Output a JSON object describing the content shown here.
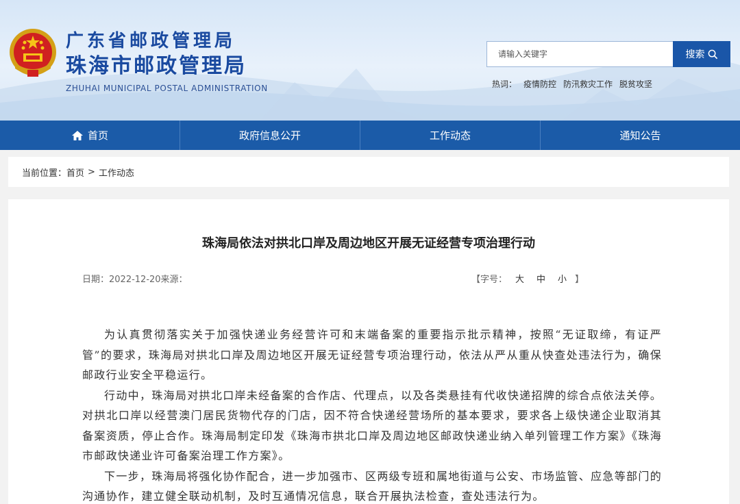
{
  "header": {
    "title_cn_1": "广东省邮政管理局",
    "title_cn_2": "珠海市邮政管理局",
    "title_en": "ZHUHAI MUNICIPAL POSTAL ADMINISTRATION",
    "search_placeholder": "请输入关键字",
    "search_button": "搜索",
    "hot_label": "热词：",
    "hot_words": [
      "疫情防控",
      "防汛救灾工作",
      "脱贫攻坚"
    ]
  },
  "nav": {
    "items": [
      "首页",
      "政府信息公开",
      "工作动态",
      "通知公告"
    ]
  },
  "breadcrumb": {
    "label": "当前位置：",
    "home": "首页",
    "sep": ">",
    "current": "工作动态"
  },
  "article": {
    "title": "珠海局依法对拱北口岸及周边地区开展无证经营专项治理行动",
    "meta": "日期：2022-12-20来源：",
    "font_size_label": "【字号：",
    "font_sizes": [
      "大",
      "中",
      "小"
    ],
    "font_size_close": "】",
    "paragraphs": [
      "为认真贯彻落实关于加强快递业务经营许可和末端备案的重要指示批示精神，按照“无证取缔，有证严管”的要求，珠海局对拱北口岸及周边地区开展无证经营专项治理行动，依法从严从重从快查处违法行为，确保邮政行业安全平稳运行。",
      "行动中，珠海局对拱北口岸未经备案的合作店、代理点，以及各类悬挂有代收快递招牌的综合点依法关停。对拱北口岸以经营澳门居民货物代存的门店，因不符合快递经营场所的基本要求，要求各上级快递企业取消其备案资质，停止合作。珠海局制定印发《珠海市拱北口岸及周边地区邮政快递业纳入单列管理工作方案》《珠海市邮政快递业许可备案治理工作方案》。",
      "下一步，珠海局将强化协作配合，进一步加强市、区两级专班和属地街道与公安、市场监管、应急等部门的沟通协作，建立健全联动机制，及时互通情况信息，联合开展执法检查，查处违法行为。"
    ]
  },
  "colors": {
    "nav_bg": "#1b5ba8",
    "title_blue": "#1a4aa0"
  }
}
